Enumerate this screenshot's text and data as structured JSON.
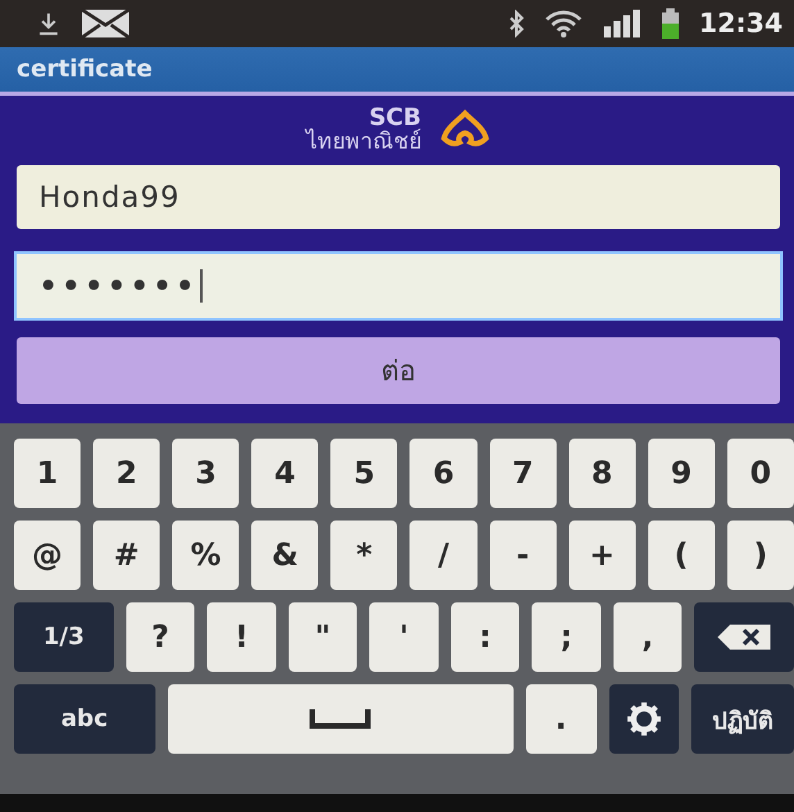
{
  "status_bar": {
    "time": "12:34"
  },
  "title_bar": {
    "title": "certificate"
  },
  "logo": {
    "name": "SCB",
    "subtitle": "ไทยพาณิชย์"
  },
  "fields": [
    {
      "kind": "text",
      "value": "Honda99",
      "focused": false
    },
    {
      "kind": "password",
      "value": "•••••••",
      "focused": true
    }
  ],
  "submit_button": {
    "label": "ต่อ"
  },
  "keyboard": {
    "rows": [
      {
        "keys": [
          {
            "kind": "char",
            "label": "1"
          },
          {
            "kind": "char",
            "label": "2"
          },
          {
            "kind": "char",
            "label": "3"
          },
          {
            "kind": "char",
            "label": "4"
          },
          {
            "kind": "char",
            "label": "5"
          },
          {
            "kind": "char",
            "label": "6"
          },
          {
            "kind": "char",
            "label": "7"
          },
          {
            "kind": "char",
            "label": "8"
          },
          {
            "kind": "char",
            "label": "9"
          },
          {
            "kind": "char",
            "label": "0"
          }
        ]
      },
      {
        "keys": [
          {
            "kind": "char",
            "label": "@"
          },
          {
            "kind": "char",
            "label": "#"
          },
          {
            "kind": "char",
            "label": "%"
          },
          {
            "kind": "char",
            "label": "&"
          },
          {
            "kind": "char",
            "label": "*"
          },
          {
            "kind": "char",
            "label": "/"
          },
          {
            "kind": "char",
            "label": "-"
          },
          {
            "kind": "char",
            "label": "+"
          },
          {
            "kind": "char",
            "label": "("
          },
          {
            "kind": "char",
            "label": ")"
          }
        ]
      },
      {
        "keys": [
          {
            "kind": "function",
            "label": "1/3"
          },
          {
            "kind": "char",
            "label": "?"
          },
          {
            "kind": "char",
            "label": "!"
          },
          {
            "kind": "char",
            "label": "\""
          },
          {
            "kind": "char",
            "label": "'"
          },
          {
            "kind": "char",
            "label": ":"
          },
          {
            "kind": "char",
            "label": ";"
          },
          {
            "kind": "char",
            "label": ","
          },
          {
            "kind": "backspace"
          }
        ]
      },
      {
        "keys": [
          {
            "kind": "wide_function",
            "label": "abc"
          },
          {
            "kind": "space"
          },
          {
            "kind": "char",
            "label": "."
          },
          {
            "kind": "settings"
          },
          {
            "kind": "function",
            "label": "ปฏิบัติ"
          }
        ]
      }
    ]
  }
}
